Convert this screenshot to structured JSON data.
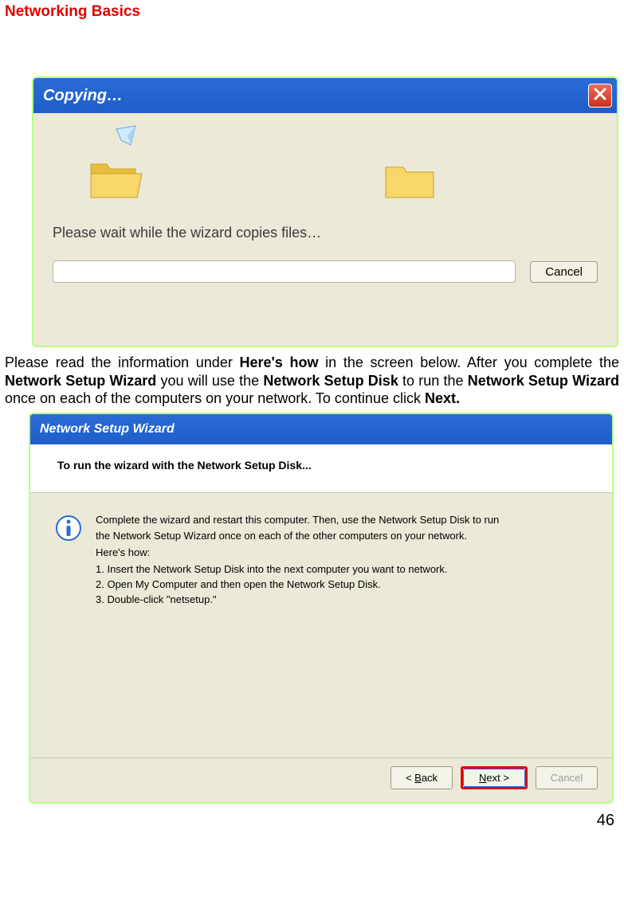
{
  "page": {
    "title": "Networking Basics",
    "number": "46"
  },
  "body_paragraph": {
    "pre1": "Please read the information under ",
    "b1": "Here's how",
    "mid1": " in the screen below.  After you complete the ",
    "b2": "Network Setup Wizard",
    "mid2": " you will use the ",
    "b3": "Network Setup Disk",
    "mid3": " to run the ",
    "b4": "Network Setup Wizard",
    "mid4": " once on each of the computers on your network. To continue click ",
    "b5": "Next."
  },
  "copy_dialog": {
    "title": "Copying…",
    "message": "Please wait while the wizard copies files…",
    "cancel": "Cancel"
  },
  "wizard_dialog": {
    "title": "Network Setup Wizard",
    "header": "To run the wizard with the Network Setup Disk...",
    "info_line1": "Complete the wizard and restart this computer. Then, use the Network Setup Disk to run",
    "info_line2": "the Network Setup Wizard once on each of the other computers on your network.",
    "hereshow": "Here's how:",
    "step1": "1.  Insert the Network Setup Disk into the next computer you want to network.",
    "step2": "2.  Open My Computer and then open the Network Setup Disk.",
    "step3": "3.  Double-click \"netsetup.\"",
    "back": "< Back",
    "next": "Next >",
    "cancel": "Cancel"
  }
}
